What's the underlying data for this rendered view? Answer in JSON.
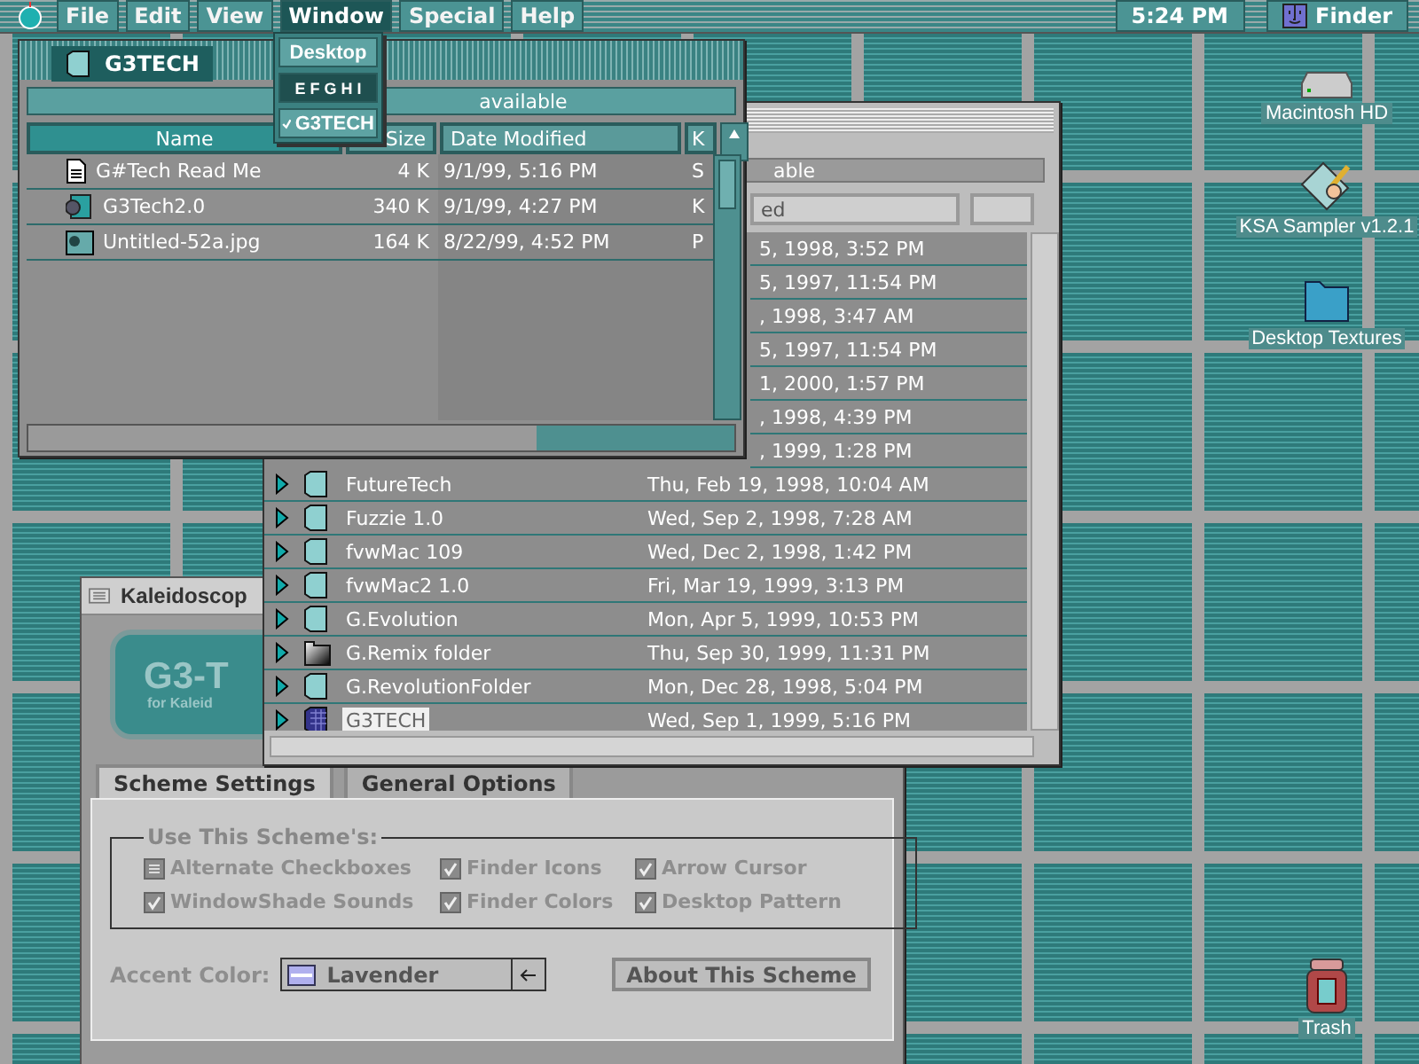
{
  "menu_bar": {
    "items": [
      {
        "label": "File",
        "selected": false
      },
      {
        "label": "Edit",
        "selected": false
      },
      {
        "label": "View",
        "selected": false
      },
      {
        "label": "Window",
        "selected": true
      },
      {
        "label": "Special",
        "selected": false
      },
      {
        "label": "Help",
        "selected": false
      }
    ],
    "clock": "5:24 PM",
    "app": "Finder"
  },
  "window_menu": {
    "items": [
      {
        "label": "Desktop",
        "kind": "item",
        "checked": false
      },
      {
        "label": "E F G H I",
        "kind": "header",
        "checked": false
      },
      {
        "label": "G3TECH",
        "kind": "item",
        "checked": true
      }
    ]
  },
  "front_window": {
    "title": "G3TECH",
    "info": "available",
    "columns": [
      "Name",
      "Size",
      "Date Modified",
      "K"
    ],
    "rows": [
      {
        "kind": "document",
        "name": "G#Tech Read Me",
        "size": "4 K",
        "date": "9/1/99, 5:16 PM",
        "column_4": "S"
      },
      {
        "kind": "application",
        "name": "G3Tech2.0",
        "size": "340 K",
        "date": "9/1/99, 4:27 PM",
        "column_4": "K"
      },
      {
        "kind": "image",
        "name": "Untitled-52a.jpg",
        "size": "164 K",
        "date": "8/22/99, 4:52 PM",
        "column_4": "P"
      }
    ]
  },
  "list_window": {
    "info": "able",
    "column": "ed",
    "rows": [
      {
        "kind": "partial",
        "date": "5, 1998, 3:52 PM",
        "selected": false
      },
      {
        "kind": "partial",
        "date": "5, 1997, 11:54 PM",
        "selected": false
      },
      {
        "kind": "partial",
        "date": ", 1998, 3:47 AM",
        "selected": false
      },
      {
        "kind": "partial",
        "date": "5, 1997, 11:54 PM",
        "selected": false
      },
      {
        "kind": "partial",
        "date": "1, 2000, 1:57 PM",
        "selected": false
      },
      {
        "kind": "partial",
        "date": ", 1998, 4:39 PM",
        "selected": false
      },
      {
        "kind": "partial",
        "date": ", 1999, 1:28 PM",
        "selected": false
      },
      {
        "kind": "folder",
        "name": "FutureTech",
        "date": "Thu, Feb 19, 1998, 10:04 AM",
        "selected": false
      },
      {
        "kind": "folder",
        "name": "Fuzzie 1.0",
        "date": "Wed, Sep 2, 1998, 7:28 AM",
        "selected": false
      },
      {
        "kind": "folder",
        "name": "fvwMac 109",
        "date": "Wed, Dec 2, 1998, 1:42 PM",
        "selected": false
      },
      {
        "kind": "folder",
        "name": "fvwMac2 1.0",
        "date": "Fri, Mar 19, 1999, 3:13 PM",
        "selected": false
      },
      {
        "kind": "folder",
        "name": "G.Evolution",
        "date": "Mon, Apr 5, 1999, 10:53 PM",
        "selected": false
      },
      {
        "kind": "dark-folder",
        "name": "G.Remix folder",
        "date": "Thu, Sep 30, 1999, 11:31 PM",
        "selected": false
      },
      {
        "kind": "folder",
        "name": "G.RevolutionFolder",
        "date": "Mon, Dec 28, 1998, 5:04 PM",
        "selected": false
      },
      {
        "kind": "grid-folder",
        "name": "G3TECH",
        "date": "Wed, Sep 1, 1999, 5:16 PM",
        "selected": true
      }
    ]
  },
  "kaleidoscope": {
    "title": "Kaleidoscop",
    "banner": {
      "logo": "G3-T",
      "subtitle": "for Kaleid"
    },
    "tabs": [
      {
        "label": "Scheme Settings",
        "selected": true
      },
      {
        "label": "General Options",
        "selected": false
      }
    ],
    "group": "Use This Scheme's:",
    "options": [
      {
        "label": "Alternate Checkboxes",
        "checked": false,
        "disabled": true
      },
      {
        "label": "Finder Icons",
        "checked": true,
        "disabled": true
      },
      {
        "label": "Arrow Cursor",
        "checked": true,
        "disabled": true
      },
      {
        "label": "WindowShade Sounds",
        "checked": true,
        "disabled": true
      },
      {
        "label": "Finder Colors",
        "checked": true,
        "disabled": true
      },
      {
        "label": "Desktop Pattern",
        "checked": true,
        "disabled": true
      }
    ],
    "accent_label": "Accent Color:",
    "accent_value": "Lavender",
    "about_button": "About This Scheme"
  },
  "desktop_icons": [
    {
      "label": "Macintosh HD",
      "kind": "disk"
    },
    {
      "label": "KSA Sampler v1.2.1",
      "kind": "document"
    },
    {
      "label": "Desktop Textures",
      "kind": "folder"
    },
    {
      "label": "Trash",
      "kind": "trash"
    }
  ]
}
